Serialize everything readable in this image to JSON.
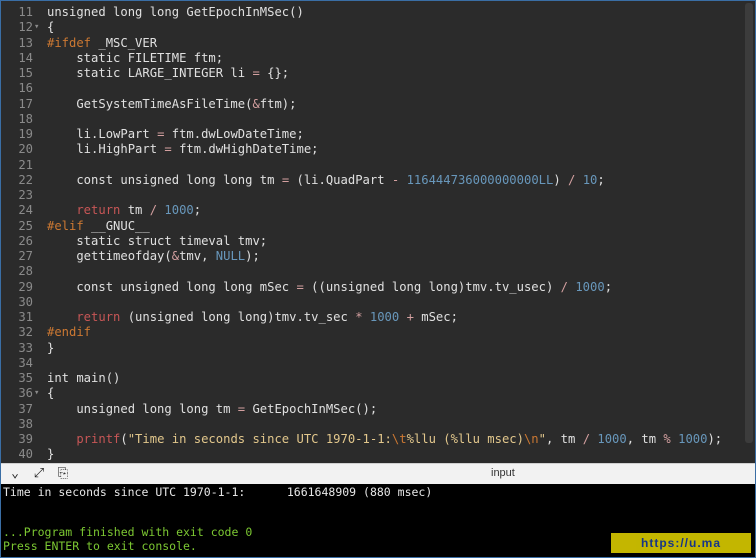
{
  "editor": {
    "lines": [
      {
        "n": "11",
        "fold": "",
        "segs": [
          [
            "kw",
            "unsigned long long GetEpochInMSec()"
          ]
        ]
      },
      {
        "n": "12",
        "fold": "▾",
        "segs": [
          [
            "kw",
            "{"
          ]
        ]
      },
      {
        "n": "13",
        "fold": "",
        "segs": [
          [
            "pp",
            "#ifdef"
          ],
          [
            "kw",
            " _MSC_VER"
          ]
        ]
      },
      {
        "n": "14",
        "fold": "",
        "segs": [
          [
            "kw",
            "    static FILETIME ftm;"
          ]
        ]
      },
      {
        "n": "15",
        "fold": "",
        "segs": [
          [
            "kw",
            "    static LARGE_INTEGER li "
          ],
          [
            "op",
            "="
          ],
          [
            "kw",
            " {};"
          ]
        ]
      },
      {
        "n": "16",
        "fold": "",
        "segs": []
      },
      {
        "n": "17",
        "fold": "",
        "segs": [
          [
            "kw",
            "    GetSystemTimeAsFileTime("
          ],
          [
            "op",
            "&"
          ],
          [
            "kw",
            "ftm);"
          ]
        ]
      },
      {
        "n": "18",
        "fold": "",
        "segs": []
      },
      {
        "n": "19",
        "fold": "",
        "segs": [
          [
            "kw",
            "    li.LowPart "
          ],
          [
            "op",
            "="
          ],
          [
            "kw",
            " ftm.dwLowDateTime;"
          ]
        ]
      },
      {
        "n": "20",
        "fold": "",
        "segs": [
          [
            "kw",
            "    li.HighPart "
          ],
          [
            "op",
            "="
          ],
          [
            "kw",
            " ftm.dwHighDateTime;"
          ]
        ]
      },
      {
        "n": "21",
        "fold": "",
        "segs": []
      },
      {
        "n": "22",
        "fold": "",
        "segs": [
          [
            "kw",
            "    const unsigned long long tm "
          ],
          [
            "op",
            "="
          ],
          [
            "kw",
            " (li.QuadPart "
          ],
          [
            "op",
            "-"
          ],
          [
            "kw",
            " "
          ],
          [
            "num",
            "116444736000000000LL"
          ],
          [
            "kw",
            ") "
          ],
          [
            "op",
            "/"
          ],
          [
            "kw",
            " "
          ],
          [
            "num",
            "10"
          ],
          [
            "kw",
            ";"
          ]
        ]
      },
      {
        "n": "23",
        "fold": "",
        "segs": []
      },
      {
        "n": "24",
        "fold": "",
        "segs": [
          [
            "fnk",
            "    return"
          ],
          [
            "kw",
            " tm "
          ],
          [
            "op",
            "/"
          ],
          [
            "kw",
            " "
          ],
          [
            "num",
            "1000"
          ],
          [
            "kw",
            ";"
          ]
        ]
      },
      {
        "n": "25",
        "fold": "",
        "segs": [
          [
            "pp",
            "#elif"
          ],
          [
            "kw",
            " __GNUC__"
          ]
        ]
      },
      {
        "n": "26",
        "fold": "",
        "segs": [
          [
            "kw",
            "    static struct timeval tmv;"
          ]
        ]
      },
      {
        "n": "27",
        "fold": "",
        "segs": [
          [
            "kw",
            "    gettimeofday("
          ],
          [
            "op",
            "&"
          ],
          [
            "kw",
            "tmv, "
          ],
          [
            "nul",
            "NULL"
          ],
          [
            "kw",
            ");"
          ]
        ]
      },
      {
        "n": "28",
        "fold": "",
        "segs": []
      },
      {
        "n": "29",
        "fold": "",
        "segs": [
          [
            "kw",
            "    const unsigned long long mSec "
          ],
          [
            "op",
            "="
          ],
          [
            "kw",
            " ((unsigned long long)tmv.tv_usec) "
          ],
          [
            "op",
            "/"
          ],
          [
            "kw",
            " "
          ],
          [
            "num",
            "1000"
          ],
          [
            "kw",
            ";"
          ]
        ]
      },
      {
        "n": "30",
        "fold": "",
        "segs": []
      },
      {
        "n": "31",
        "fold": "",
        "segs": [
          [
            "fnk",
            "    return"
          ],
          [
            "kw",
            " (unsigned long long)tmv.tv_sec "
          ],
          [
            "op",
            "*"
          ],
          [
            "kw",
            " "
          ],
          [
            "num",
            "1000"
          ],
          [
            "kw",
            " "
          ],
          [
            "op",
            "+"
          ],
          [
            "kw",
            " mSec;"
          ]
        ]
      },
      {
        "n": "32",
        "fold": "",
        "segs": [
          [
            "pp",
            "#endif"
          ]
        ]
      },
      {
        "n": "33",
        "fold": "",
        "segs": [
          [
            "kw",
            "}"
          ]
        ]
      },
      {
        "n": "34",
        "fold": "",
        "segs": []
      },
      {
        "n": "35",
        "fold": "",
        "segs": [
          [
            "kw",
            "int main()"
          ]
        ]
      },
      {
        "n": "36",
        "fold": "▾",
        "segs": [
          [
            "kw",
            "{"
          ]
        ]
      },
      {
        "n": "37",
        "fold": "",
        "segs": [
          [
            "kw",
            "    unsigned long long tm "
          ],
          [
            "op",
            "="
          ],
          [
            "kw",
            " GetEpochInMSec();"
          ]
        ]
      },
      {
        "n": "38",
        "fold": "",
        "segs": []
      },
      {
        "n": "39",
        "fold": "",
        "segs": [
          [
            "fnk",
            "    printf"
          ],
          [
            "kw",
            "("
          ],
          [
            "str",
            "\"Time in seconds since UTC 1970-1-1:"
          ],
          [
            "esc",
            "\\t"
          ],
          [
            "str",
            "%llu (%llu msec)"
          ],
          [
            "esc",
            "\\n"
          ],
          [
            "str",
            "\""
          ],
          [
            "kw",
            ", tm "
          ],
          [
            "op",
            "/"
          ],
          [
            "kw",
            " "
          ],
          [
            "num",
            "1000"
          ],
          [
            "kw",
            ", tm "
          ],
          [
            "op",
            "%"
          ],
          [
            "kw",
            " "
          ],
          [
            "num",
            "1000"
          ],
          [
            "kw",
            ");"
          ]
        ]
      },
      {
        "n": "40",
        "fold": "",
        "segs": [
          [
            "kw",
            "}"
          ]
        ]
      }
    ]
  },
  "toolbar": {
    "collapse_icon": "chevron-down-icon",
    "expand_icon": "expand-arrows-icon",
    "copy_icon": "copy-icon",
    "input_label": "input"
  },
  "console": {
    "output_line": "Time in seconds since UTC 1970-1-1:      1661648909 (880 msec)",
    "finish_line": "...Program finished with exit code 0",
    "enter_line": "Press ENTER to exit console."
  },
  "watermark": {
    "text": "https://u.ma"
  }
}
